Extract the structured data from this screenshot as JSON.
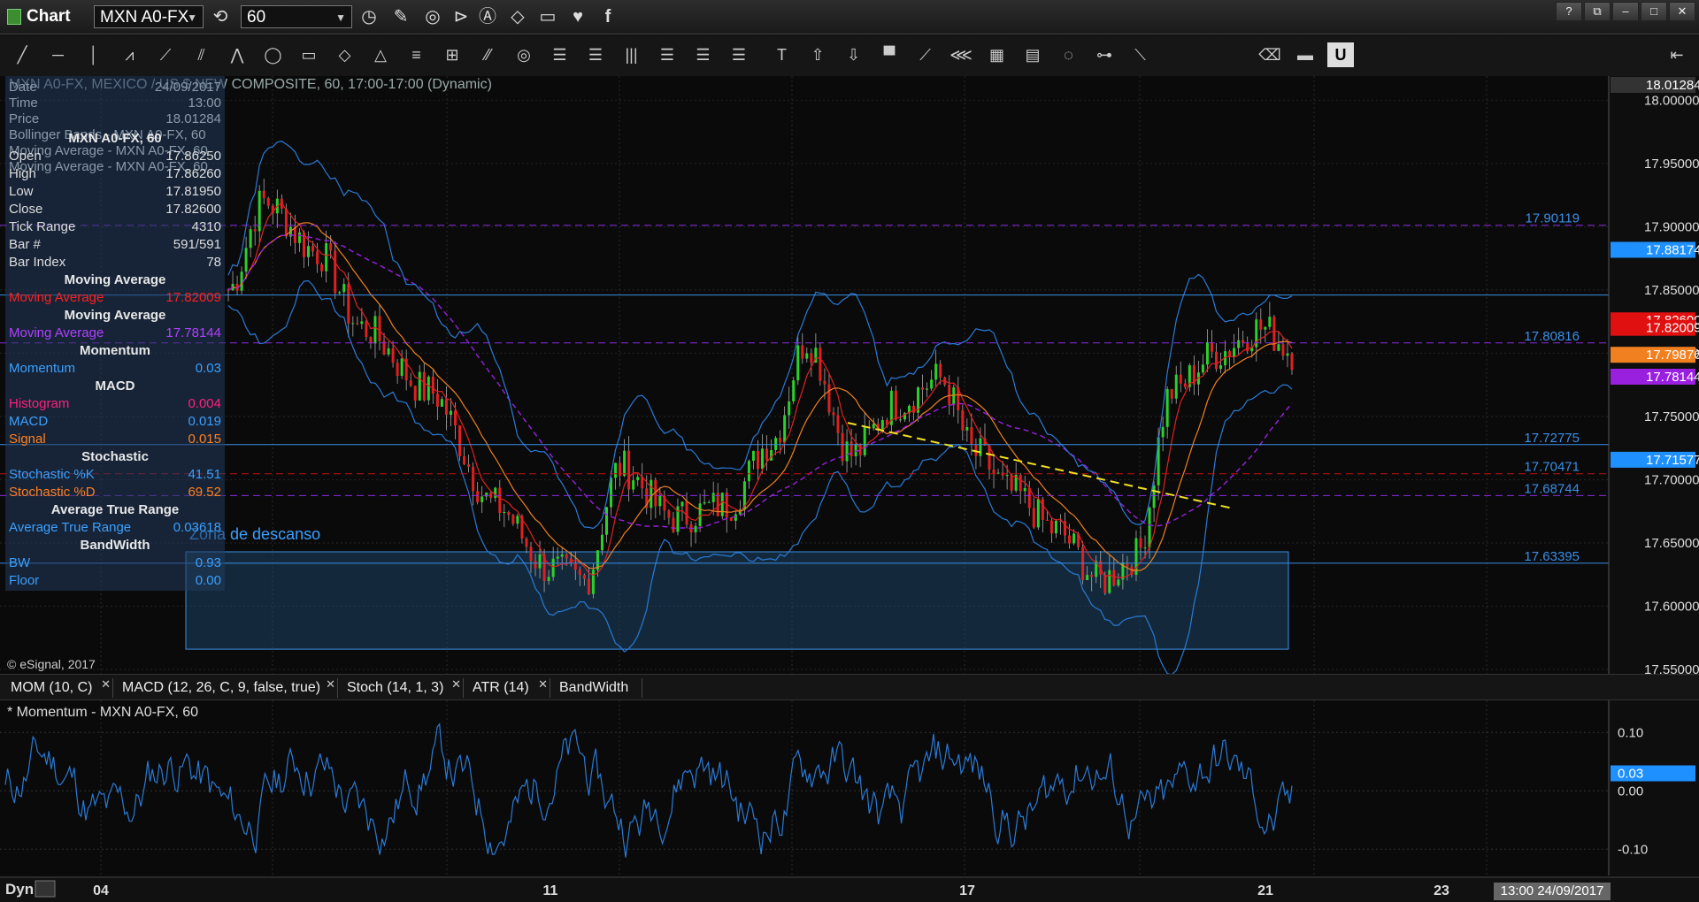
{
  "window": {
    "title": "Chart",
    "symbol": "MXN A0-FX",
    "interval": "60",
    "controls": [
      "?",
      "⧉",
      "–",
      "□",
      "✕"
    ]
  },
  "icons": {
    "titlebar": [
      "link-icon",
      "clock-icon",
      "pencil-icon",
      "chart-icon",
      "play-icon",
      "alert-icon",
      "tag-icon",
      "comment-icon",
      "twitter-icon",
      "facebook-icon"
    ],
    "drawing": [
      "line-icon",
      "horizontal-line-icon",
      "vertical-line-icon",
      "zigzag-icon",
      "fib-fan-icon",
      "pitchfork-icon",
      "gann-icon",
      "ellipse-icon",
      "rectangle-icon",
      "diamond-icon",
      "triangle-icon",
      "channel-icon",
      "cycle-icon",
      "parallel-icon",
      "target-icon",
      "fib-retracement-icon",
      "fib-ext-icon",
      "vertical-lines-icon",
      "fib-time-icon",
      "arc-icon",
      "levels-icon",
      "text-icon",
      "arrow-up-icon",
      "arrow-down-icon",
      "bar-icon",
      "speed-icon",
      "fan-icon",
      "grid-icon",
      "mob-icon",
      "ellipse-tool-icon",
      "pti-icon",
      "regression-icon",
      "eraser-icon",
      "annotate-icon",
      "magnet-icon"
    ]
  },
  "chart": {
    "title": "MXN A0-FX, MEXICO / US $ NEW COMPOSITE, 60, 17:00-17:00 (Dynamic)",
    "copyright": "© eSignal, 2017",
    "zone_label": "Zona de descanso",
    "price_ticks": [
      "18.00000",
      "17.95000",
      "17.90000",
      "17.85000",
      "17.80000",
      "17.75000",
      "17.70000",
      "17.65000",
      "17.60000",
      "17.55000"
    ],
    "ylim": [
      17.55,
      18.01284
    ],
    "top_price": "18.01284",
    "levels": [
      {
        "label": "17.90119",
        "value": 17.90119,
        "style": "dashed",
        "color": "#8a2be2"
      },
      {
        "label": "17.80816",
        "value": 17.80816,
        "style": "dashed",
        "color": "#8a2be2"
      },
      {
        "label": "17.72775",
        "value": 17.72775,
        "style": "solid",
        "color": "#3a8ee6"
      },
      {
        "label": "17.70471",
        "value": 17.70471,
        "style": "dashed",
        "color": "#c01010"
      },
      {
        "label": "17.68744",
        "value": 17.68744,
        "style": "dashed",
        "color": "#8a2be2"
      },
      {
        "label": "17.63395",
        "value": 17.63395,
        "style": "solid",
        "color": "#3a8ee6"
      }
    ],
    "resistance_line": 17.846,
    "badges": [
      {
        "label": "17.88174",
        "value": 17.88174,
        "color": "#1e90ff"
      },
      {
        "label": "17.82600",
        "value": 17.826,
        "color": "#e01010"
      },
      {
        "label": "17.82009",
        "value": 17.82009,
        "color": "#e01010"
      },
      {
        "label": "17.79876",
        "value": 17.79876,
        "color": "#f08020"
      },
      {
        "label": "17.78144",
        "value": 17.78144,
        "color": "#9a20e0"
      },
      {
        "label": "17.71577",
        "value": 17.71577,
        "color": "#1e90ff"
      }
    ],
    "x_labels": [
      "04",
      "11",
      "17",
      "21",
      "23"
    ]
  },
  "info_panel": {
    "overlay": [
      {
        "label": "Date",
        "value": "24/09/2017"
      },
      {
        "label": "Time",
        "value": "13:00"
      },
      {
        "label": "Price",
        "value": "18.01284"
      },
      {
        "label": "Bollinger Bands - MXN A0-FX, 60",
        "value": ""
      },
      {
        "label": "Moving Average - MXN A0-FX, 60",
        "value": ""
      },
      {
        "label": "Moving Average - MXN A0-FX, 60",
        "value": ""
      }
    ],
    "header": "MXN A0-FX, 60",
    "rows": [
      {
        "label": "Open",
        "value": "17.86250",
        "color": "#dddddd"
      },
      {
        "label": "High",
        "value": "17.86260",
        "color": "#dddddd"
      },
      {
        "label": "Low",
        "value": "17.81950",
        "color": "#dddddd"
      },
      {
        "label": "Close",
        "value": "17.82600",
        "color": "#dddddd"
      },
      {
        "label": "Tick Range",
        "value": "4310",
        "color": "#dddddd"
      },
      {
        "label": "Bar #",
        "value": "591/591",
        "color": "#dddddd"
      },
      {
        "label": "Bar Index",
        "value": "78",
        "color": "#dddddd"
      }
    ],
    "sections": [
      {
        "title": "Moving Average",
        "rows": [
          {
            "label": "Moving Average",
            "value": "17.82009",
            "color": "#ff2020"
          }
        ]
      },
      {
        "title": "Moving Average",
        "rows": [
          {
            "label": "Moving Average",
            "value": "17.78144",
            "color": "#b040ff"
          }
        ]
      },
      {
        "title": "Momentum",
        "rows": [
          {
            "label": "Momentum",
            "value": "0.03",
            "color": "#3aa0ff"
          }
        ]
      },
      {
        "title": "MACD",
        "rows": [
          {
            "label": "Histogram",
            "value": "0.004",
            "color": "#ff2080"
          },
          {
            "label": "MACD",
            "value": "0.019",
            "color": "#3aa0ff"
          },
          {
            "label": "Signal",
            "value": "0.015",
            "color": "#ff8020"
          }
        ]
      },
      {
        "title": "Stochastic",
        "rows": [
          {
            "label": "Stochastic %K",
            "value": "41.51",
            "color": "#3aa0ff"
          },
          {
            "label": "Stochastic %D",
            "value": "69.52",
            "color": "#ff8020"
          }
        ]
      },
      {
        "title": "Average True Range",
        "rows": [
          {
            "label": "Average True Range",
            "value": "0.03618",
            "color": "#3aa0ff"
          }
        ]
      },
      {
        "title": "BandWidth",
        "rows": [
          {
            "label": "BW",
            "value": "0.93",
            "color": "#3aa0ff"
          },
          {
            "label": "Floor",
            "value": "0.00",
            "color": "#3aa0ff"
          }
        ]
      }
    ]
  },
  "tabs": [
    "MOM (10, C)",
    "MACD (12, 26, C, 9, false, true)",
    "Stoch (14, 1, 3)",
    "ATR (14)",
    "BandWidth"
  ],
  "momentum": {
    "title": "* Momentum - MXN A0-FX, 60",
    "ticks": [
      "0.10",
      "0.00",
      "-0.10"
    ],
    "current": "0.03",
    "ylim": [
      -0.145,
      0.155
    ]
  },
  "footer": {
    "mode": "Dyn",
    "datetime": "13:00 24/09/2017"
  }
}
